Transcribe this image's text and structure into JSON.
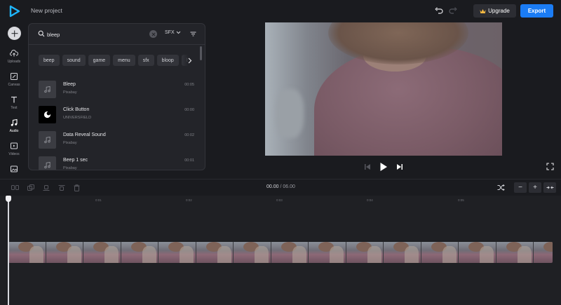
{
  "header": {
    "project_title": "New project",
    "upgrade_label": "Upgrade",
    "export_label": "Export"
  },
  "nav": {
    "items": [
      {
        "label": "Uploads",
        "icon": "upload-icon"
      },
      {
        "label": "Canvas",
        "icon": "canvas-icon"
      },
      {
        "label": "Text",
        "icon": "text-icon"
      },
      {
        "label": "Audio",
        "icon": "music-note-icon",
        "active": true
      },
      {
        "label": "Videos",
        "icon": "video-icon"
      },
      {
        "label": "",
        "icon": "image-icon"
      }
    ]
  },
  "search": {
    "value": "bleep",
    "category": "SFX"
  },
  "tags": [
    "beep",
    "sound",
    "game",
    "menu",
    "sfx",
    "bloop",
    "bl"
  ],
  "sounds": [
    {
      "title": "Bleep",
      "author": "Pixabay",
      "duration": "00:05",
      "thumb": "note"
    },
    {
      "title": "Click Button",
      "author": "UNIVERSFIELD",
      "duration": "00:00",
      "thumb": "logo"
    },
    {
      "title": "Data Reveal Sound",
      "author": "Pixabay",
      "duration": "00:02",
      "thumb": "note"
    },
    {
      "title": "Beep 1 sec",
      "author": "Pixabay",
      "duration": "00:01",
      "thumb": "note"
    }
  ],
  "timeline": {
    "current_time": "00.00",
    "separator": "/",
    "total_time": "06.00",
    "ruler": [
      "0",
      "0:01",
      "0:02",
      "0:03",
      "0:04",
      "0:05"
    ],
    "zoom_out_label": "−",
    "zoom_in_label": "+"
  },
  "colors": {
    "accent": "#1b7cf4",
    "background": "#1a1b1f",
    "panel": "#232429"
  }
}
